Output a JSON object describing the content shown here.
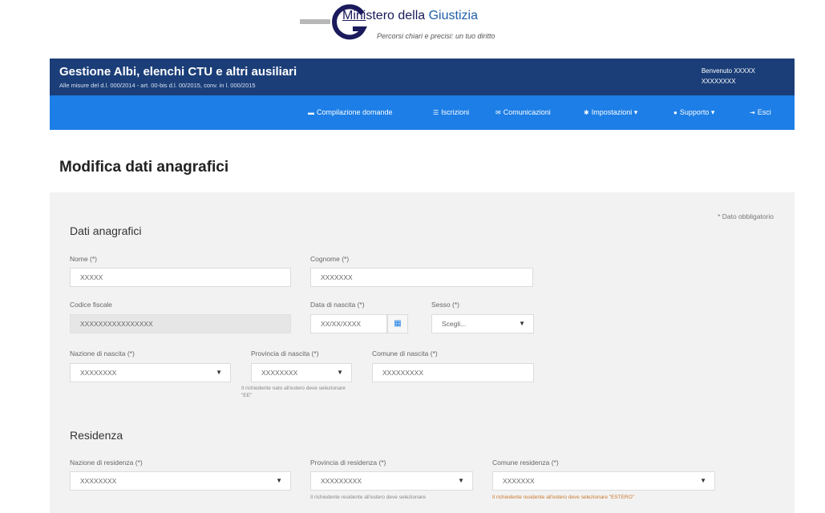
{
  "top_text": "... Ministero della Giustizia ...",
  "logo": {
    "title_prefix": "Mini",
    "title_rest": "stero della ",
    "title_giustizia": "Giustizia",
    "tagline": "Percorsi chiari e precisi: un tuo diritto"
  },
  "header": {
    "title": "Gestione Albi, elenchi CTU e altri ausiliari",
    "subtitle": "Alle misure del d.l. 000/2014 - art. 00-bis d.l. 00/2015, conv. in l. 000/2015",
    "welcome": "Benvenuto XXXXX",
    "user_id": "XXXXXXXX"
  },
  "nav": {
    "items": [
      {
        "label": "Compilazione domande",
        "icon": "folder-icon"
      },
      {
        "label": "Iscrizioni",
        "icon": "list-icon"
      },
      {
        "label": "Comunicazioni",
        "icon": "envelope-icon"
      },
      {
        "label": "Impostazioni ▾",
        "icon": "gear-icon"
      },
      {
        "label": "Supporto ▾",
        "icon": "help-icon"
      },
      {
        "label": "Esci",
        "icon": "logout-icon"
      }
    ]
  },
  "page_title": "Modifica dati anagrafici",
  "mandatory_note": "* Dato obbligatorio",
  "anagrafica": {
    "section_title": "Dati anagrafici",
    "nome": {
      "label": "Nome (*)",
      "value": "XXXXX"
    },
    "cognome": {
      "label": "Cognome (*)",
      "value": "XXXXXXX"
    },
    "codice_fiscale": {
      "label": "Codice fiscale",
      "value": "XXXXXXXXXXXXXXXX"
    },
    "data_nascita": {
      "label": "Data di nascita (*)",
      "value": "XX/XX/XXXX"
    },
    "sesso": {
      "label": "Sesso (*)",
      "value": "Scegli..."
    },
    "nazione_nascita": {
      "label": "Nazione di nascita (*)",
      "value": "XXXXXXXX"
    },
    "provincia_nascita": {
      "label": "Provincia di nascita (*)",
      "value": "XXXXXXXX",
      "hint": "Il richiedente nato all'estero deve selezionare \"EE\""
    },
    "comune_nascita": {
      "label": "Comune di nascita (*)",
      "value": "XXXXXXXXX"
    }
  },
  "residenza": {
    "section_title": "Residenza",
    "nazione": {
      "label": "Nazione di residenza (*)",
      "value": "XXXXXXXX"
    },
    "provincia": {
      "label": "Provincia di residenza (*)",
      "value": "XXXXXXXXX",
      "hint": "Il richiedente residente all'estero deve selezionare"
    },
    "comune": {
      "label": "Comune residenza (*)",
      "value": "XXXXXXX",
      "hint": "Il richiedente residente all'estero deve selezionare \"ESTERO\""
    }
  }
}
